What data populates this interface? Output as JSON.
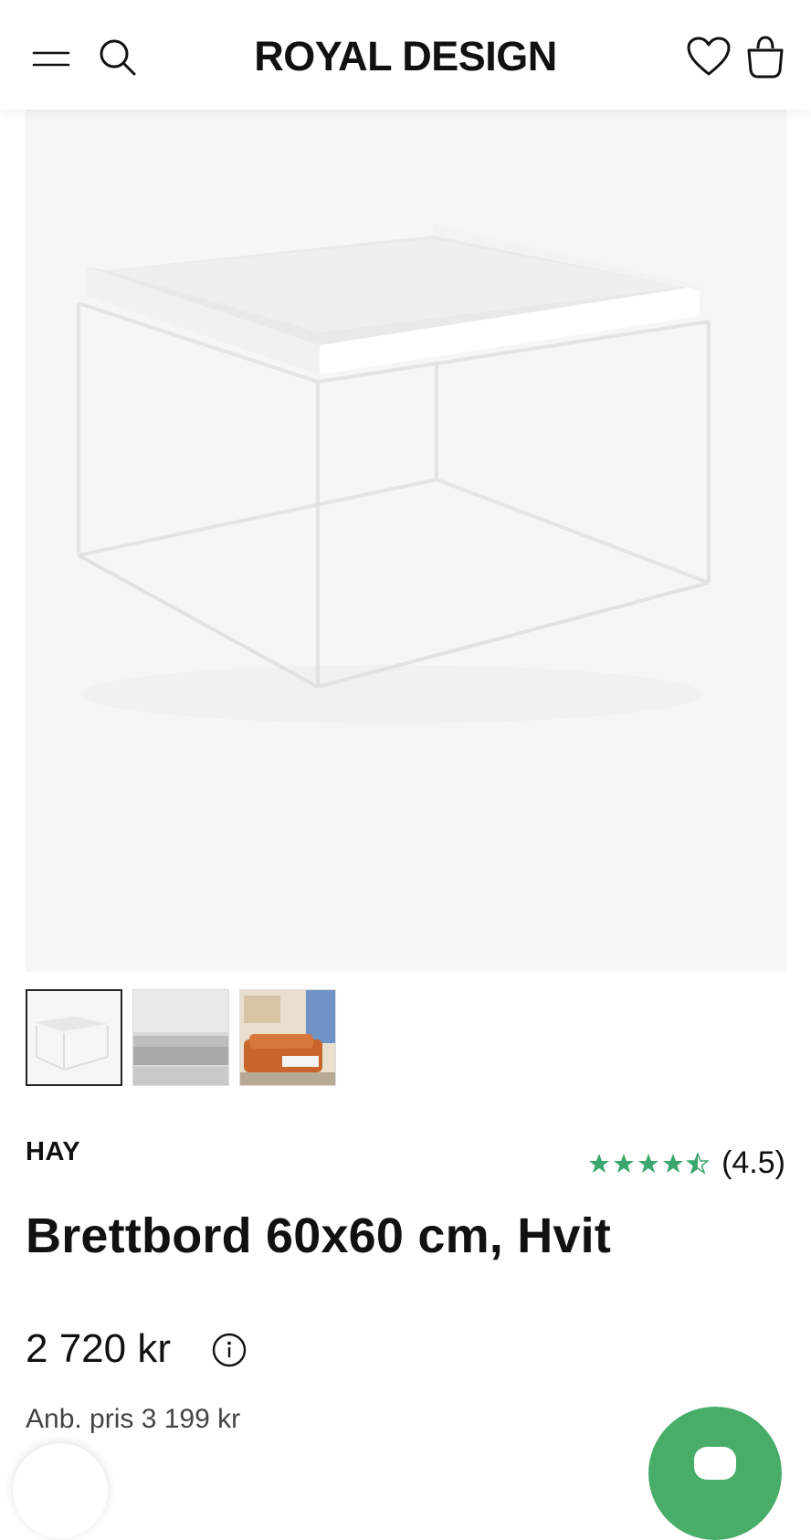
{
  "header": {
    "logo": "ROYAL DESIGN",
    "icons": [
      "menu-icon",
      "search-icon",
      "heart-icon",
      "bag-icon"
    ]
  },
  "product": {
    "brand": "HAY",
    "rating": {
      "stars": 4.5,
      "text": "(4.5)",
      "color": "#3aa76d"
    },
    "title": "Brettbord 60x60 cm, Hvit",
    "price": "2 720 kr",
    "rrp": "Anb. pris 3 199 kr"
  },
  "gallery": {
    "thumbnails": [
      "tray-table-white",
      "grey-sofa-room",
      "orange-sofa-living-room"
    ],
    "selected_index": 0
  },
  "colors": {
    "accent": "#49ad6a",
    "text": "#111111",
    "gallery_bg": "#f6f6f6"
  }
}
